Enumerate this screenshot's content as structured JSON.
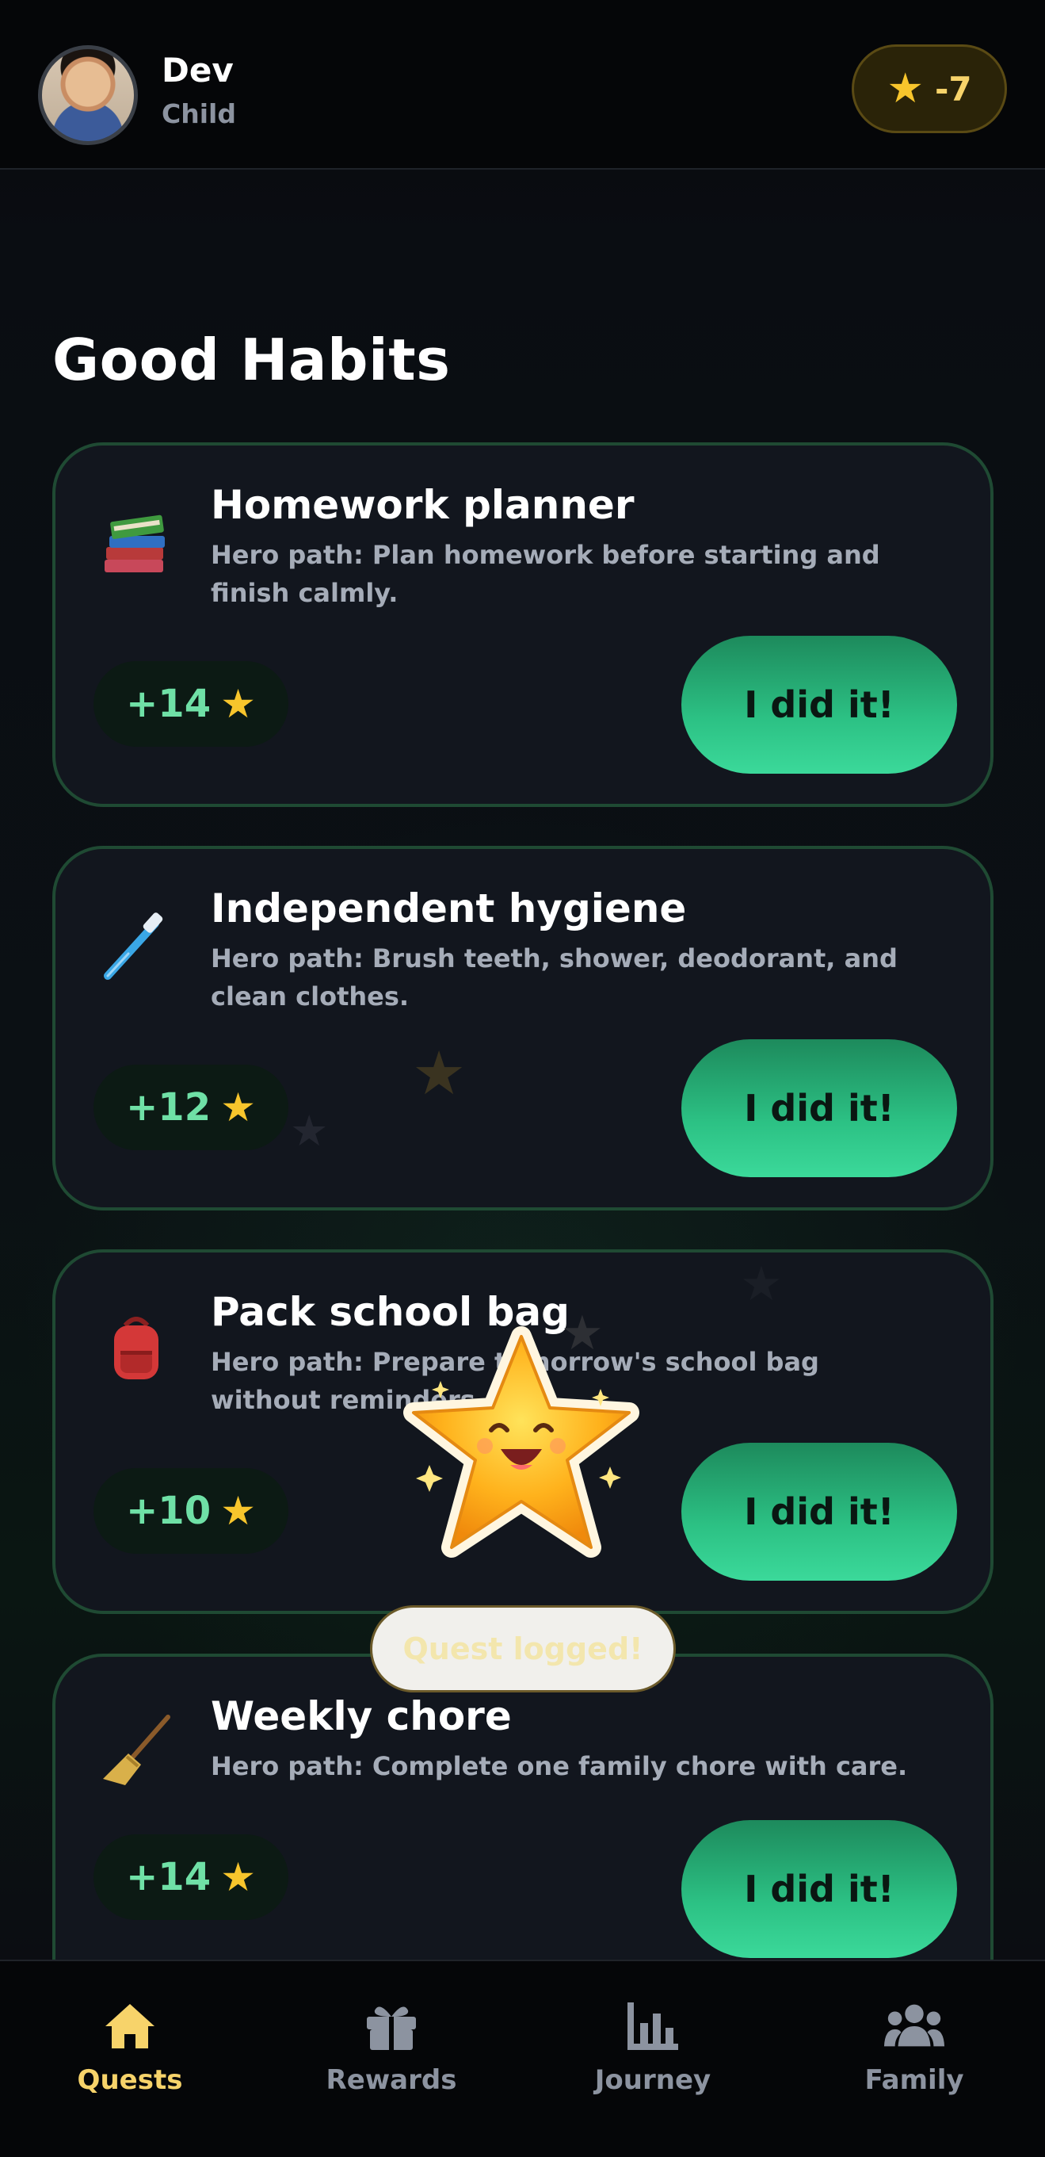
{
  "header": {
    "user_name": "Dev",
    "user_role": "Child",
    "star_count": "-7"
  },
  "section_title": "Good Habits",
  "habits": [
    {
      "icon": "books-icon",
      "title": "Homework planner",
      "description": "Hero path: Plan homework before starting and finish calmly.",
      "points": "+14",
      "button": "I did it!"
    },
    {
      "icon": "toothbrush-icon",
      "title": "Independent hygiene",
      "description": "Hero path: Brush teeth, shower, deodorant, and clean clothes.",
      "points": "+12",
      "button": "I did it!"
    },
    {
      "icon": "backpack-icon",
      "title": "Pack school bag",
      "description": "Hero path: Prepare tomorrow's school bag without reminders.",
      "points": "+10",
      "button": "I did it!"
    },
    {
      "icon": "broom-icon",
      "title": "Weekly chore",
      "description": "Hero path: Complete one family chore with care.",
      "points": "+14",
      "button": "I did it!"
    }
  ],
  "toast": "Quest logged!",
  "nav": [
    {
      "label": "Quests",
      "icon": "home-icon",
      "active": true
    },
    {
      "label": "Rewards",
      "icon": "gift-icon",
      "active": false
    },
    {
      "label": "Journey",
      "icon": "bar-chart-icon",
      "active": false
    },
    {
      "label": "Family",
      "icon": "people-icon",
      "active": false
    }
  ],
  "colors": {
    "accent_green": "#2cc184",
    "star_gold": "#f7c52c",
    "card_border": "#1f4a33",
    "nav_active": "#f7d36a"
  }
}
